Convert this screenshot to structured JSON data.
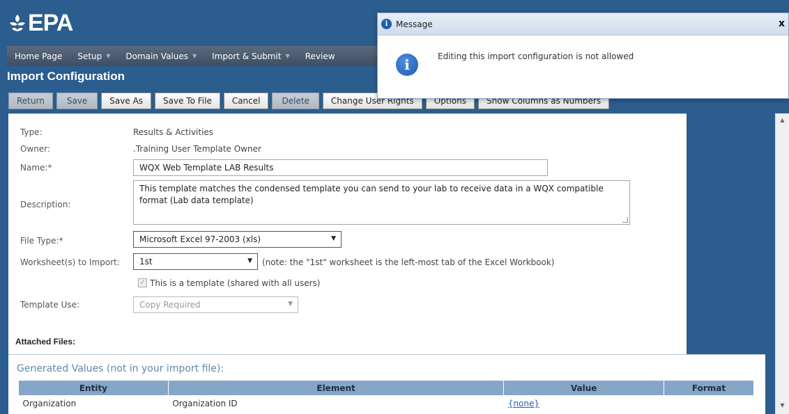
{
  "header": {
    "logo_text": "EPA"
  },
  "nav": {
    "items": [
      {
        "label": "Home Page",
        "dropdown": false
      },
      {
        "label": "Setup",
        "dropdown": true
      },
      {
        "label": "Domain Values",
        "dropdown": true
      },
      {
        "label": "Import & Submit",
        "dropdown": true
      },
      {
        "label": "Review",
        "dropdown": false
      }
    ]
  },
  "page": {
    "title": "Import Configuration"
  },
  "toolbar": {
    "return_label": "Return",
    "save_label": "Save",
    "save_as_label": "Save As",
    "save_to_file_label": "Save To File",
    "cancel_label": "Cancel",
    "delete_label": "Delete",
    "change_user_rights_label": "Change User Rights",
    "options_label": "Options",
    "show_columns_label": "Show Columns as Numbers"
  },
  "form": {
    "type_label": "Type:",
    "type_value": "Results & Activities",
    "owner_label": "Owner:",
    "owner_value": ".Training User Template Owner",
    "name_label": "Name:*",
    "name_value": "WQX Web Template LAB Results",
    "description_label": "Description:",
    "description_value": "This template matches the condensed template you can send to your lab to receive data in a WQX compatible format (Lab data template)",
    "file_type_label": "File Type:*",
    "file_type_value": "Microsoft Excel 97-2003 (xls)",
    "worksheet_label": "Worksheet(s) to Import:",
    "worksheet_value": "1st",
    "worksheet_note": "(note: the \"1st\" worksheet is the left-most tab of the Excel Workbook)",
    "template_checkbox_label": "This is a template (shared with all users)",
    "template_use_label": "Template Use:",
    "template_use_value": "Copy Required",
    "attached_files_label": "Attached Files:"
  },
  "generated": {
    "title": "Generated Values (not in your import file):",
    "columns": [
      "Entity",
      "Element",
      "Value",
      "Format"
    ],
    "rows": [
      {
        "entity": "Organization",
        "element": "Organization ID",
        "value": "{none}",
        "format": ""
      }
    ]
  },
  "dialog": {
    "title": "Message",
    "close": "x",
    "message": "Editing this import configuration is not allowed",
    "icon": "info-icon"
  },
  "colors": {
    "header_bg": "#2b5d8e",
    "nav_bg": "#4a5a6e",
    "table_header_bg": "#86a6c8",
    "info_blue": "#1f5fad"
  }
}
